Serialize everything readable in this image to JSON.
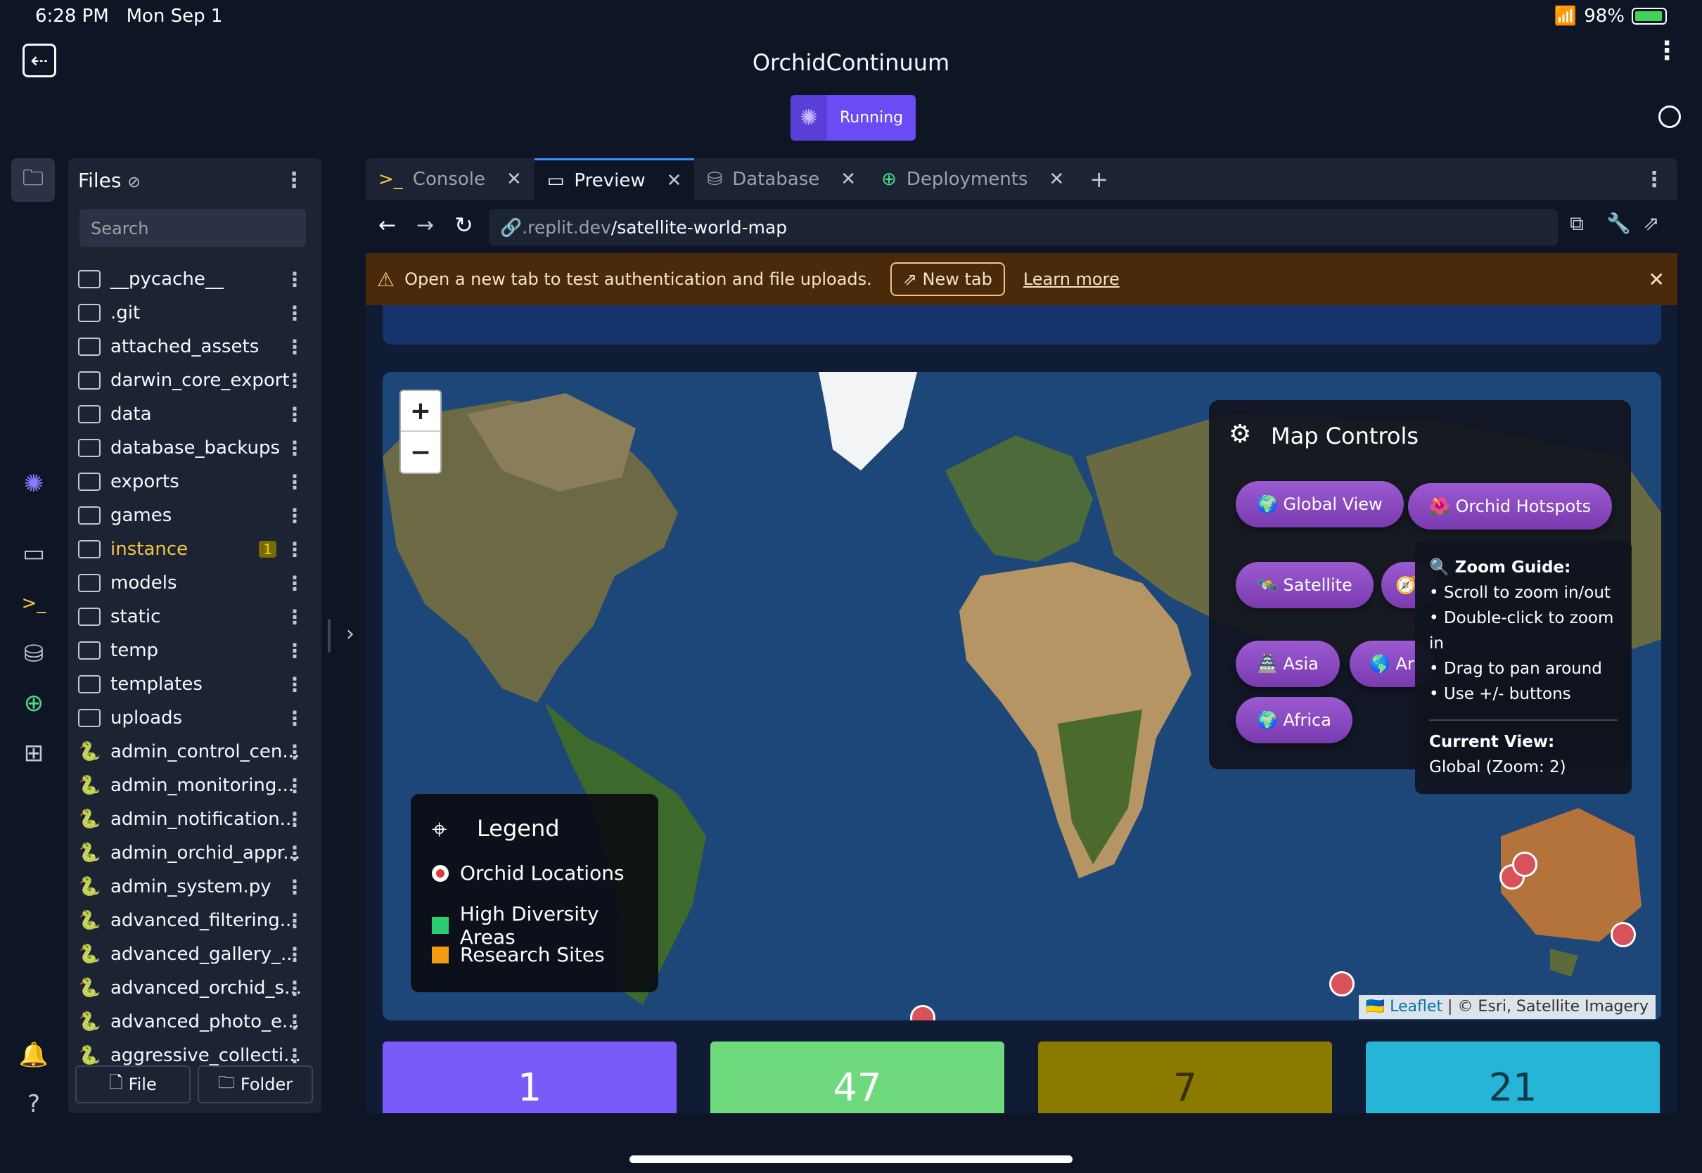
{
  "status_bar": {
    "time": "6:28 PM",
    "date": "Mon Sep 1",
    "battery": "98%"
  },
  "header": {
    "title": "OrchidContinuum",
    "run_status": "Running"
  },
  "files": {
    "title": "Files",
    "search_placeholder": "Search",
    "items": [
      {
        "name": "__pycache__",
        "type": "folder"
      },
      {
        "name": ".git",
        "type": "folder"
      },
      {
        "name": "attached_assets",
        "type": "folder"
      },
      {
        "name": "darwin_core_export",
        "type": "folder"
      },
      {
        "name": "data",
        "type": "folder"
      },
      {
        "name": "database_backups",
        "type": "folder"
      },
      {
        "name": "exports",
        "type": "folder"
      },
      {
        "name": "games",
        "type": "folder"
      },
      {
        "name": "instance",
        "type": "folder",
        "badge": "1"
      },
      {
        "name": "models",
        "type": "folder"
      },
      {
        "name": "static",
        "type": "folder"
      },
      {
        "name": "temp",
        "type": "folder"
      },
      {
        "name": "templates",
        "type": "folder"
      },
      {
        "name": "uploads",
        "type": "folder"
      },
      {
        "name": "admin_control_cen...",
        "type": "python"
      },
      {
        "name": "admin_monitoring...",
        "type": "python"
      },
      {
        "name": "admin_notification...",
        "type": "python"
      },
      {
        "name": "admin_orchid_appr...",
        "type": "python"
      },
      {
        "name": "admin_system.py",
        "type": "python"
      },
      {
        "name": "advanced_filtering...",
        "type": "python"
      },
      {
        "name": "advanced_gallery_...",
        "type": "python"
      },
      {
        "name": "advanced_orchid_s...",
        "type": "python"
      },
      {
        "name": "advanced_photo_e...",
        "type": "python"
      },
      {
        "name": "aggressive_collecti...",
        "type": "python"
      }
    ],
    "new_file_label": "File",
    "new_folder_label": "Folder"
  },
  "tabs": [
    {
      "label": "Console",
      "icon": "terminal-icon"
    },
    {
      "label": "Preview",
      "icon": "monitor-icon",
      "active": true
    },
    {
      "label": "Database",
      "icon": "database-icon"
    },
    {
      "label": "Deployments",
      "icon": "deployments-icon"
    }
  ],
  "url": {
    "host": ".replit.dev",
    "path": "/satellite-world-map"
  },
  "banner": {
    "text": "Open a new tab to test authentication and file uploads.",
    "new_tab": "New tab",
    "learn_more": "Learn more"
  },
  "map": {
    "controls_title": "Map Controls",
    "buttons": [
      "🌍 Global View",
      "🌺 Orchid Hotspots",
      "🛰️ Satellite",
      "🏯 Asia",
      "🌎 Ar",
      "🌍 Africa"
    ],
    "zoom_guide": {
      "title": "Zoom Guide:",
      "lines": [
        "• Scroll to zoom in/out",
        "• Double-click to zoom in",
        "• Drag to pan around",
        "• Use +/- buttons"
      ],
      "current_label": "Current View:",
      "current_value": "Global (Zoom: 2)"
    },
    "legend": {
      "title": "Legend",
      "items": [
        {
          "label": "Orchid Locations",
          "color": "#e03a3a"
        },
        {
          "label": "High Diversity Areas",
          "color": "#2ecc71"
        },
        {
          "label": "Research Sites",
          "color": "#f39c12"
        }
      ]
    },
    "attribution": {
      "leaflet": "Leaflet",
      "rest": " | © Esri, Satellite Imagery"
    },
    "zoom_in": "+",
    "zoom_out": "−"
  },
  "stats": [
    {
      "value": "1",
      "color": "#7a5af8"
    },
    {
      "value": "47",
      "color": "#6fd97e"
    },
    {
      "value": "7",
      "color": "#8a7a00"
    },
    {
      "value": "21",
      "color": "#26b5d6"
    }
  ]
}
